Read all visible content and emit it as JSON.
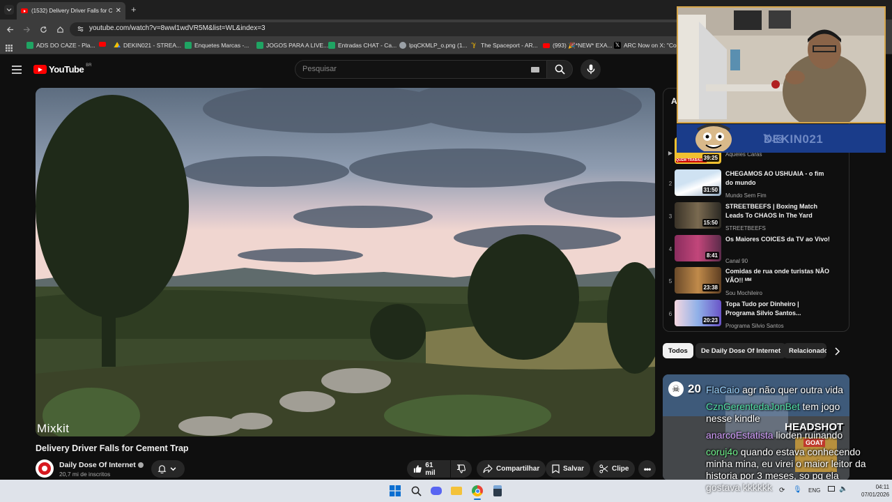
{
  "browser": {
    "tab_title": "(1532) Delivery Driver Falls for C",
    "url": "youtube.com/watch?v=8wwl1wdVR5M&list=WL&index=3",
    "bookmarks": [
      {
        "label": "ADS DO CAZE - Pla...",
        "icon": "sheets-icon"
      },
      {
        "label": "",
        "icon": "youtube-icon"
      },
      {
        "label": "DEKIN021 - STREA...",
        "icon": "drive-icon"
      },
      {
        "label": "Enquetes Marcas -...",
        "icon": "sheets-icon"
      },
      {
        "label": "JOGOS PARA A LIVE...",
        "icon": "sheets-icon"
      },
      {
        "label": "Entradas CHAT - Ca...",
        "icon": "sheets-icon"
      },
      {
        "label": "lpqCKMLP_o.png (1...",
        "icon": "globe-icon"
      },
      {
        "label": "The Spaceport - AR...",
        "icon": "spaceport-icon"
      },
      {
        "label": "(993) 🎉*NEW* EXA...",
        "icon": "youtube-icon"
      },
      {
        "label": "ARC Now on X: \"Co...",
        "icon": "x-icon"
      }
    ]
  },
  "youtube": {
    "logo_text": "YouTube",
    "country_code": "BR",
    "search_placeholder": "Pesquisar",
    "video": {
      "watermark": "Mixkit",
      "title": "Delivery Driver Falls for Cement Trap",
      "channel": "Daily Dose Of Internet",
      "subscribers": "20,7 mi de inscritos",
      "likes": "61 mil",
      "share_label": "Compartilhar",
      "save_label": "Salvar",
      "clip_label": "Clipe"
    },
    "playlist": {
      "header_letter": "A",
      "items": [
        {
          "index": "",
          "channel": "Aqueles Caras",
          "duration": "39:25",
          "title": "",
          "thumb_label": "QUEM TRABALHA"
        },
        {
          "index": "2",
          "title": "CHEGAMOS AO USHUAIA - o fim do mundo",
          "channel": "Mundo Sem Fim",
          "duration": "31:50"
        },
        {
          "index": "3",
          "title": "STREETBEEFS | Boxing Match Leads To CHAOS In The Yard",
          "channel": "STREETBEEFS",
          "duration": "15:50"
        },
        {
          "index": "4",
          "title": "Os Maiores COICES da TV ao Vivo!",
          "channel": "Canal 90",
          "duration": "8:41"
        },
        {
          "index": "5",
          "title": "Comidas de rua onde turistas NÃO VÃO!! ᴹᴹ",
          "channel": "Sou Mochileiro",
          "duration": "23:38"
        },
        {
          "index": "6",
          "title": "Topa Tudo por Dinheiro | Programa Silvio Santos...",
          "channel": "Programa Silvio Santos",
          "duration": "20:23"
        }
      ]
    },
    "chips": [
      "Todos",
      "De Daily Dose Of Internet",
      "Relacionado"
    ]
  },
  "stream_overlay": {
    "handle": "DEKIN021",
    "chat_counter": "20",
    "headshot_label": "HEADSHOT",
    "goat_label": "GOAT",
    "chat": [
      {
        "user": "FlaCaio",
        "user_color": "#9fd6ff",
        "text": " agr não quer outra vida"
      },
      {
        "user": "CznGerentedaJonBet",
        "user_color": "#52e0a6",
        "text": " tem jogo"
      },
      {
        "user": "",
        "user_color": "#ffffff",
        "text": "nesse kindle"
      },
      {
        "user": "anarcoEstatista",
        "user_color": "#d6a0ff",
        "text": " lioden ruinando"
      },
      {
        "user": "coruj4o",
        "user_color": "#6ef08a",
        "text": " quando estava conhecendo"
      },
      {
        "user": "",
        "user_color": "#ffffff",
        "text": "minha mina, eu virei o maior leitor da"
      },
      {
        "user": "",
        "user_color": "#ffffff",
        "text": "historia por 3 meses, so pq ela"
      },
      {
        "user": "",
        "user_color": "#ffffff",
        "text": "gostava kkkkkk"
      }
    ]
  },
  "taskbar": {
    "language": "ENG",
    "time": "04:11",
    "date": "07/01/2026"
  }
}
